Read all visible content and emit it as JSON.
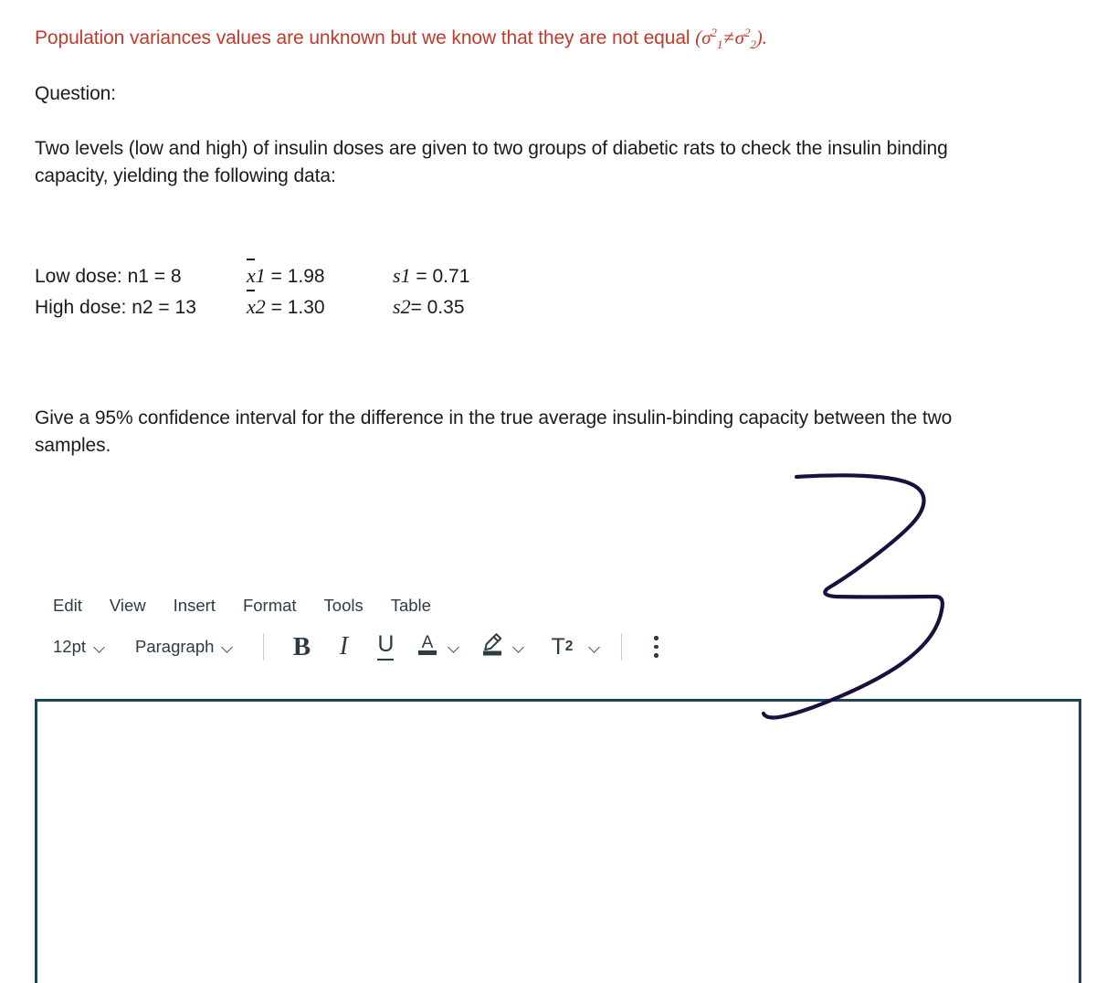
{
  "document": {
    "variance_note": {
      "text": "Population variances values are unknown but we know that they are not equal",
      "math": "(σ₁² ≠ σ₂²).",
      "color": "#bf3b2b",
      "sigma": "σ",
      "exp": "2",
      "sub1": "1",
      "sub2": "2",
      "neq": "≠",
      "open_paren": "(",
      "close_paren": ").",
      "space": " "
    },
    "question_label": "Question:",
    "intro_paragraph": "Two levels (low and high) of insulin doses are given to two groups of diabetic rats to check the insulin binding capacity, yielding the following data:",
    "data_rows": [
      {
        "label": "Low dose: n1 = 8",
        "mean_symbol": "x",
        "mean_sub": "1",
        "mean_eq": "= 1.98",
        "sd_symbol": "s",
        "sd_sub": "1",
        "sd_eq": "= 0.71"
      },
      {
        "label": "High dose: n2 = 13",
        "mean_symbol": "x",
        "mean_sub": "2",
        "mean_eq": "= 1.30",
        "sd_symbol": "s",
        "sd_sub": "2",
        "sd_eq": "= 0.35"
      }
    ],
    "ci_paragraph": "Give a 95% confidence interval for the difference in the true average insulin-binding capacity between the two samples."
  },
  "editor": {
    "menu": [
      {
        "label": "Edit"
      },
      {
        "label": "View"
      },
      {
        "label": "Insert"
      },
      {
        "label": "Format"
      },
      {
        "label": "Tools"
      },
      {
        "label": "Table"
      }
    ],
    "toolbar": {
      "font_size": "12pt",
      "block_format": "Paragraph",
      "bold": "B",
      "italic": "I",
      "underline": "U",
      "text_color": "A",
      "superscript_label": "T",
      "superscript_exp": "2",
      "accent_color": "#2d3b45",
      "border_color": "#1d4555"
    }
  },
  "annotation": {
    "stroke_color": "#1a1040",
    "shape": "handwritten-digit-3"
  }
}
